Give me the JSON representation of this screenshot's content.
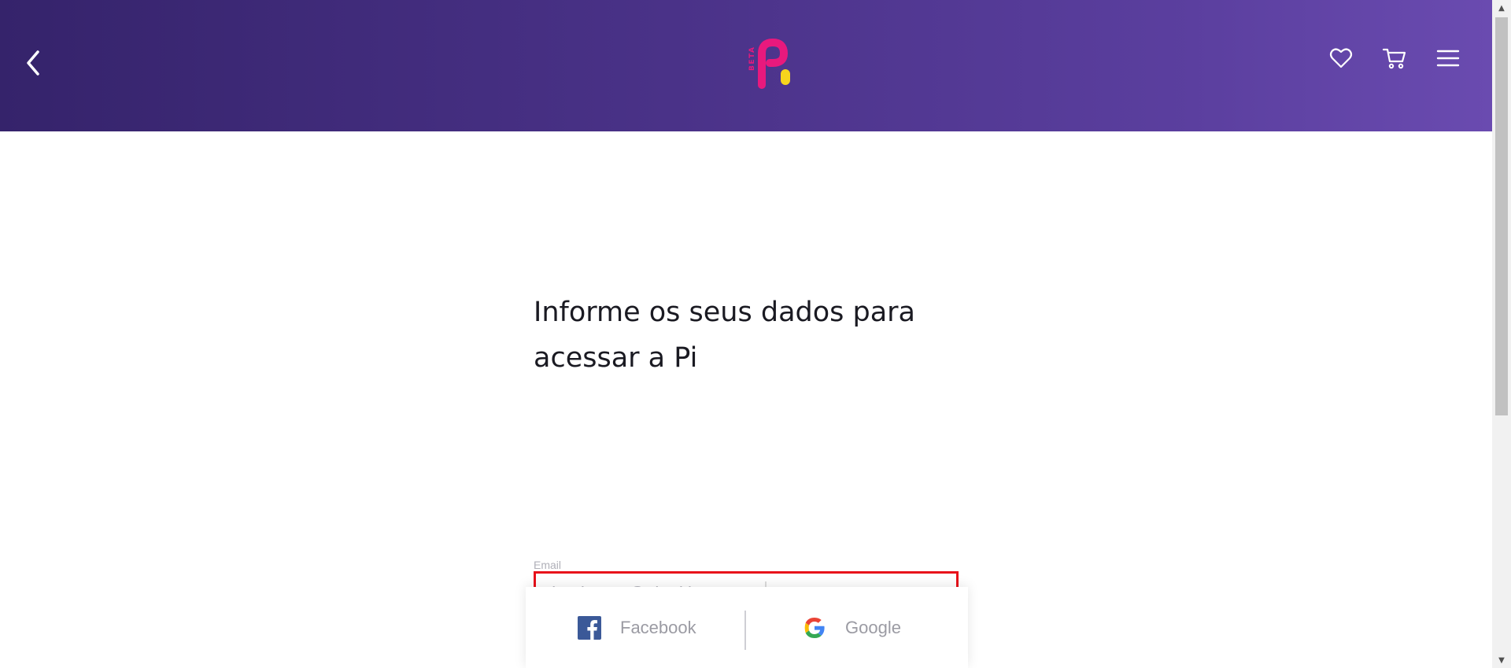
{
  "header": {
    "logo_text": "BETA",
    "colors": {
      "gradient_start": "#35236b",
      "gradient_end": "#6a4bb0",
      "logo_pink": "#e8197d",
      "logo_yellow": "#f7d51d"
    },
    "icons": [
      "chevron-left-icon",
      "heart-icon",
      "cart-icon",
      "menu-icon"
    ]
  },
  "main": {
    "title_line1": "Informe os seus dados para",
    "title_line2": "acessar a Pi"
  },
  "form": {
    "email_label": "Email",
    "email_value": "ajanderson@abcd.br"
  },
  "social": {
    "facebook_label": "Facebook",
    "google_label": "Google",
    "colors": {
      "facebook": "#3b5998",
      "google_blue": "#4285f4",
      "google_red": "#ea4335",
      "google_yellow": "#fbbc05",
      "google_green": "#34a853"
    }
  },
  "accent": {
    "focus_border": "#e8101a"
  }
}
